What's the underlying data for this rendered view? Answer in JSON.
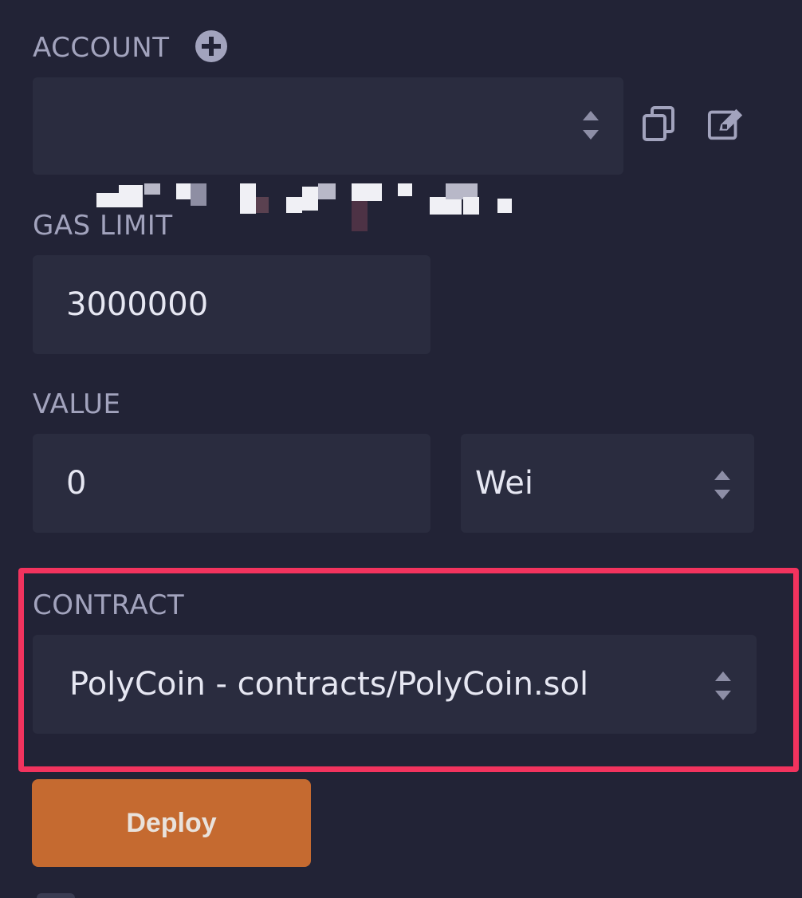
{
  "account": {
    "label": "ACCOUNT",
    "add_icon": "plus-circle-icon",
    "copy_icon": "copy-icon",
    "edit_icon": "edit-icon"
  },
  "gas_limit": {
    "label": "GAS LIMIT",
    "value": "3000000"
  },
  "value": {
    "label": "VALUE",
    "amount": "0",
    "unit": "Wei"
  },
  "contract": {
    "label": "CONTRACT",
    "selected": "PolyCoin - contracts/PolyCoin.sol"
  },
  "deploy": {
    "label": "Deploy"
  },
  "colors": {
    "background": "#222336",
    "field": "#2a2c3f",
    "label": "#a2a3bd",
    "highlight": "#f2335e",
    "deploy": "#c56a30"
  }
}
